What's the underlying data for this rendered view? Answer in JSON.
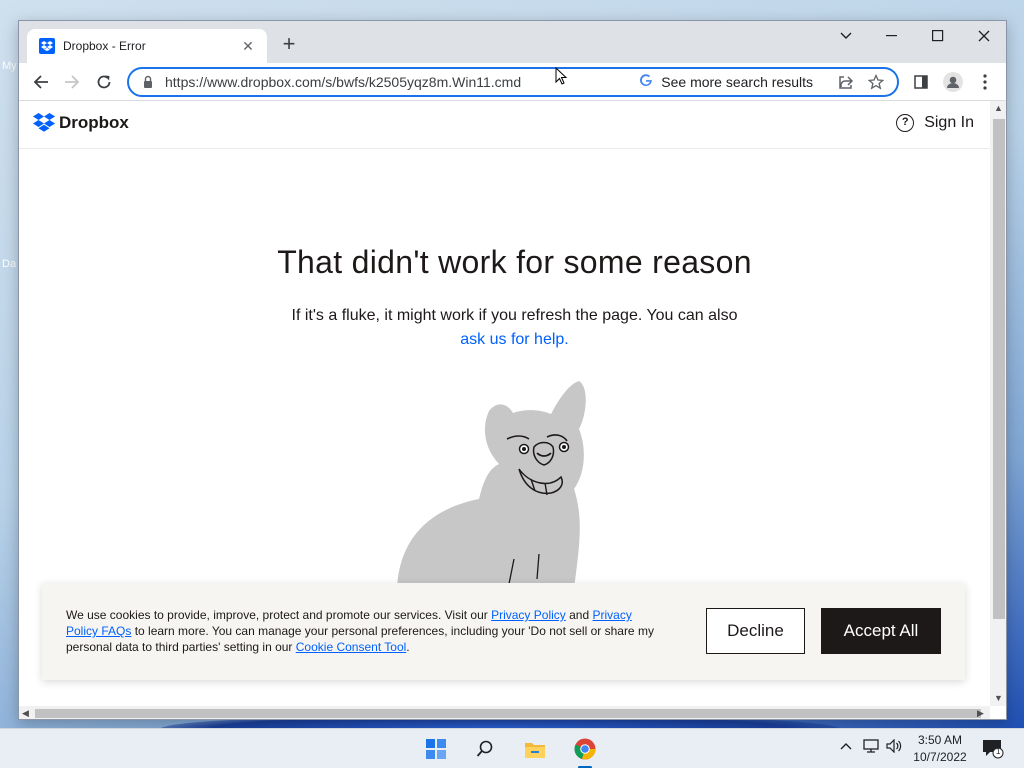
{
  "browser": {
    "tab_title": "Dropbox - Error",
    "tab_close_glyph": "✕",
    "new_tab_glyph": "+",
    "url": "https://www.dropbox.com/s/bwfs/k2505yqz8m.Win11.cmd",
    "search_hint": "See more search results"
  },
  "desktop": {
    "icon_labels": [
      "My",
      "Da"
    ]
  },
  "site": {
    "logo_text": "Dropbox",
    "sign_in_label": "Sign In"
  },
  "error": {
    "title": "That didn't work for some reason",
    "body": "If it's a fluke, it might work if you refresh the page. You can also",
    "link": "ask us for help."
  },
  "cookie_banner": {
    "text_1": "We use cookies to provide, improve, protect and promote our services. Visit our ",
    "link_privacy": "Privacy Policy",
    "text_2": " and ",
    "link_faqs": "Privacy Policy FAQs",
    "text_3": " to learn more. You can manage your personal preferences, including your 'Do not sell or share my personal data to third parties' setting in our ",
    "link_consent": "Cookie Consent Tool",
    "text_4": ".",
    "decline_label": "Decline",
    "accept_label": "Accept All"
  },
  "taskbar": {
    "time": "3:50 AM",
    "date": "10/7/2022",
    "notification_count": "1"
  },
  "colors": {
    "dropbox_blue": "#0061fe",
    "focus_ring": "#1a73e8",
    "dark": "#1e1919"
  },
  "icons": [
    "dropbox-favicon",
    "close-icon",
    "plus-icon",
    "chevron-down-icon",
    "minimize-icon",
    "maximize-icon",
    "window-close-icon",
    "back-icon",
    "forward-icon",
    "reload-icon",
    "lock-icon",
    "google-icon",
    "share-icon",
    "star-icon",
    "side-panel-icon",
    "profile-icon",
    "kebab-menu-icon",
    "help-icon",
    "windows-start-icon",
    "search-icon",
    "file-explorer-icon",
    "chrome-icon",
    "chevron-up-icon",
    "network-icon",
    "volume-icon",
    "notification-icon"
  ]
}
